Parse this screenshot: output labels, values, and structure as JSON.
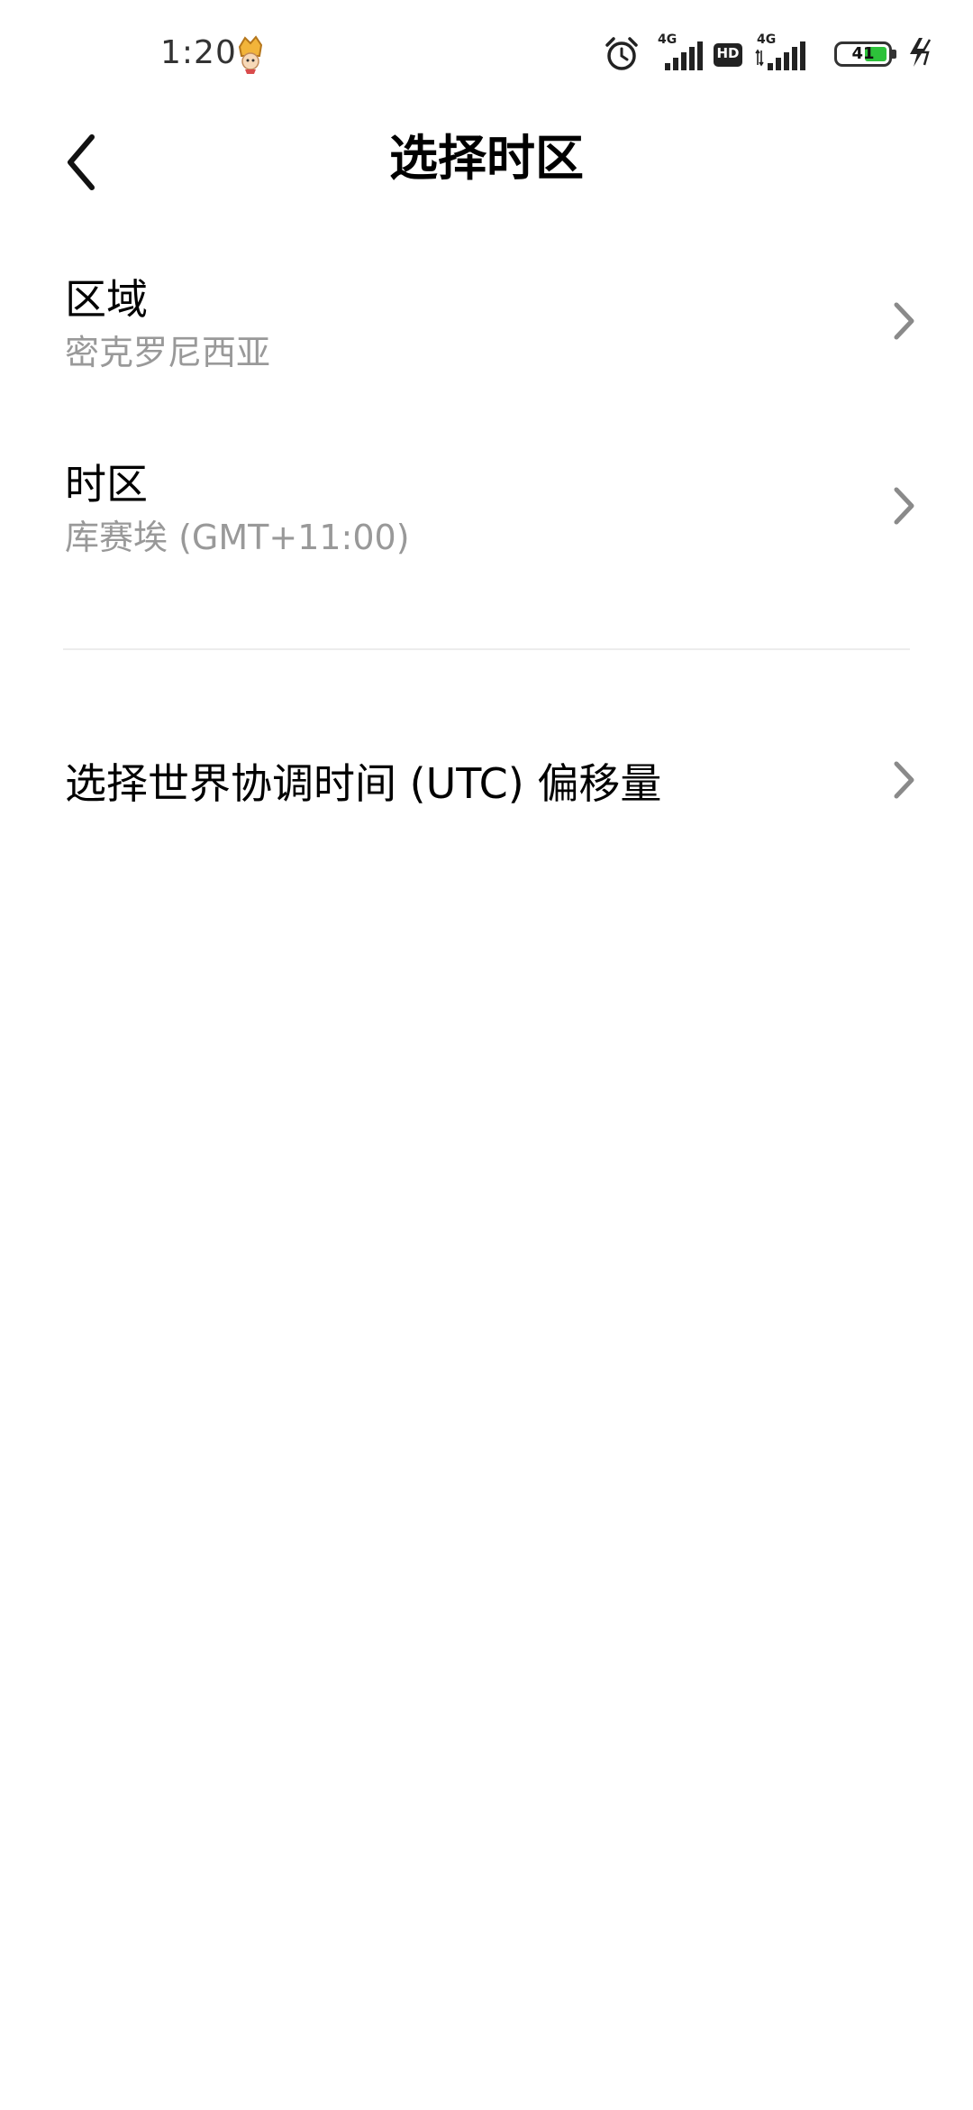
{
  "status_bar": {
    "time": "1:20",
    "signal1_label": "4G",
    "hd_label": "HD",
    "signal2_label": "4G",
    "battery_level": "41",
    "battery_fraction": 0.41
  },
  "header": {
    "title": "选择时区"
  },
  "items": [
    {
      "title": "区域",
      "subtitle": "密克罗尼西亚"
    },
    {
      "title": "时区",
      "subtitle": "库赛埃 (GMT+11:00)"
    },
    {
      "title": "选择世界协调时间 (UTC) 偏移量"
    }
  ],
  "colors": {
    "background": "#ffffff",
    "text_primary": "#000000",
    "text_secondary": "#999999",
    "chevron": "#8a8a8a",
    "divider": "#ececec",
    "battery_fill": "#2dc23a"
  }
}
